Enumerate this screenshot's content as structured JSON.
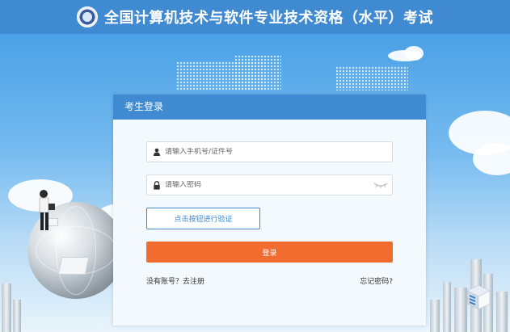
{
  "header": {
    "title": "全国计算机技术与软件专业技术资格（水平）考试",
    "logo_icon": "ruankao-logo-icon"
  },
  "login": {
    "title": "考生登录",
    "phone_placeholder": "请输入手机号/证件号",
    "password_placeholder": "请输入密码",
    "verify_label": "点击按钮进行验证",
    "submit_label": "登录",
    "register_prompt": "没有账号？",
    "register_link": "去注册",
    "forgot_link": "忘记密码?"
  },
  "icons": {
    "user": "user-icon",
    "lock": "lock-icon",
    "eye": "eye-closed-icon"
  },
  "colors": {
    "header_blue": "#3f8ad1",
    "login_orange": "#f26c30",
    "card_bg": "#f3f9fd"
  }
}
